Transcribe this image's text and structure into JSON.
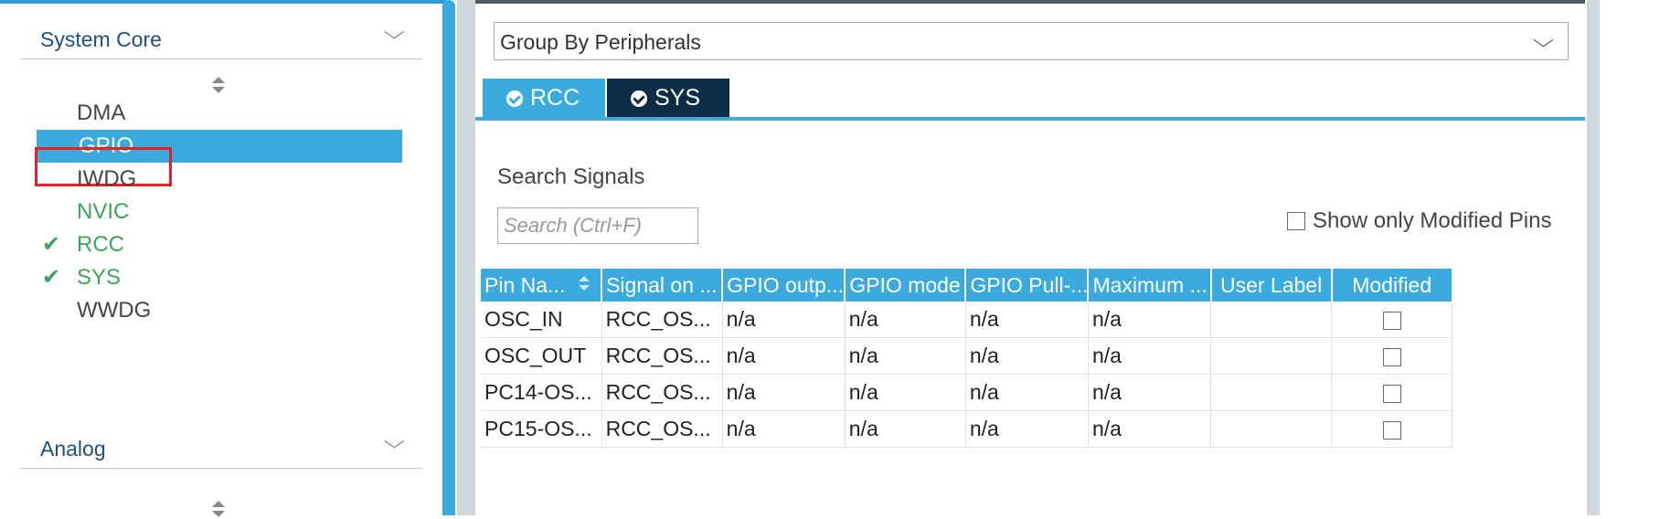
{
  "left_panel": {
    "system_core": {
      "title": "System Core"
    },
    "peripherals": [
      {
        "label": "DMA",
        "state": "normal",
        "checked": false
      },
      {
        "label": "GPIO",
        "state": "selected",
        "checked": false
      },
      {
        "label": "IWDG",
        "state": "normal",
        "checked": false
      },
      {
        "label": "NVIC",
        "state": "green",
        "checked": false
      },
      {
        "label": "RCC",
        "state": "green",
        "checked": true
      },
      {
        "label": "SYS",
        "state": "green",
        "checked": true
      },
      {
        "label": "WWDG",
        "state": "normal",
        "checked": false
      }
    ],
    "analog": {
      "title": "Analog"
    },
    "checkmark_glyph": "✔",
    "selection_highlight_color": "#e52222"
  },
  "right_panel": {
    "group_by": {
      "value": "Group By Peripherals"
    },
    "tabs": [
      {
        "label": "RCC",
        "active": false
      },
      {
        "label": "SYS",
        "active": true
      }
    ],
    "search": {
      "label": "Search Signals",
      "placeholder": "Search (Ctrl+F)"
    },
    "show_modified": {
      "label": "Show only Modified Pins",
      "checked": false
    },
    "table": {
      "columns": [
        "Pin Na...",
        "Signal on ...",
        "GPIO outp...",
        "GPIO mode",
        "GPIO Pull-...",
        "Maximum ...",
        "User Label",
        "Modified"
      ],
      "rows": [
        [
          "OSC_IN",
          "RCC_OS...",
          "n/a",
          "n/a",
          "n/a",
          "n/a",
          "",
          false
        ],
        [
          "OSC_OUT",
          "RCC_OS...",
          "n/a",
          "n/a",
          "n/a",
          "n/a",
          "",
          false
        ],
        [
          "PC14-OS...",
          "RCC_OS...",
          "n/a",
          "n/a",
          "n/a",
          "n/a",
          "",
          false
        ],
        [
          "PC15-OS...",
          "RCC_OS...",
          "n/a",
          "n/a",
          "n/a",
          "n/a",
          "",
          false
        ]
      ]
    }
  },
  "colors": {
    "accent_blue": "#3aaadf",
    "dark_tab": "#0d2c46",
    "enabled_green": "#3ca45a",
    "title_blue": "#1e4f7d"
  },
  "icons": {
    "chevron": "chevron-down-icon",
    "sort": "sort-icon",
    "check": "check-icon",
    "ok_circle": "check-circle-icon"
  }
}
